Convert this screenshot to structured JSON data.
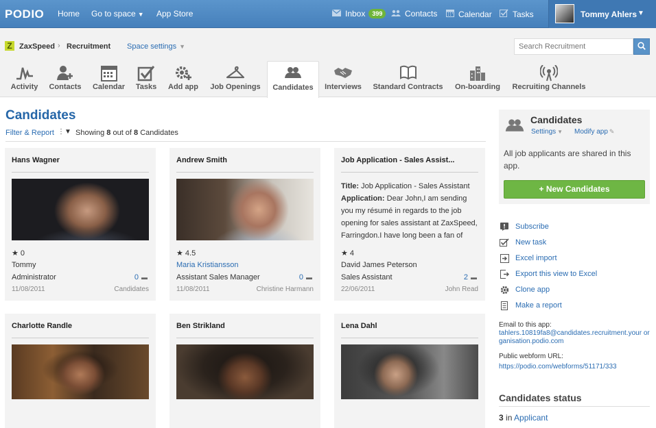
{
  "topbar": {
    "logo": "PODIO",
    "nav": {
      "home": "Home",
      "go_to_space": "Go to space",
      "app_store": "App Store"
    },
    "inbox_label": "Inbox",
    "inbox_count": "399",
    "contacts": "Contacts",
    "calendar": "Calendar",
    "tasks": "Tasks",
    "user_name": "Tommy Ahlers"
  },
  "spacebar": {
    "space_name": "ZaxSpeed",
    "separator": "›",
    "app_name": "Recruitment",
    "space_settings": "Space settings",
    "search_placeholder": "Search Recruitment"
  },
  "tabs": [
    {
      "label": "Activity",
      "icon": "activity-icon"
    },
    {
      "label": "Contacts",
      "icon": "add-contact-icon"
    },
    {
      "label": "Calendar",
      "icon": "calendar-icon"
    },
    {
      "label": "Tasks",
      "icon": "tasks-icon"
    },
    {
      "label": "Add app",
      "icon": "add-app-icon"
    },
    {
      "label": "Job Openings",
      "icon": "hanger-icon"
    },
    {
      "label": "Candidates",
      "icon": "people-icon",
      "active": true
    },
    {
      "label": "Interviews",
      "icon": "handshake-icon"
    },
    {
      "label": "Standard Contracts",
      "icon": "book-icon"
    },
    {
      "label": "On-boarding",
      "icon": "buildings-icon"
    },
    {
      "label": "Recruiting Channels",
      "icon": "broadcast-icon"
    }
  ],
  "main": {
    "title": "Candidates",
    "filter_link": "Filter & Report",
    "showing_prefix": "Showing",
    "showing_count": "8",
    "showing_mid": "out of",
    "showing_total": "8",
    "showing_suffix": "Candidates"
  },
  "cards": [
    {
      "title": "Hans Wagner",
      "rating": "★ 0",
      "line1": "Tommy",
      "line2": "Administrator",
      "comments": "0",
      "date": "11/08/2011",
      "owner": "Candidates"
    },
    {
      "title": "Andrew Smith",
      "rating": "★ 4.5",
      "line1": "Maria Kristiansson",
      "line2": "Assistant Sales Manager",
      "comments": "0",
      "date": "11/08/2011",
      "owner": "Christine Harmann"
    },
    {
      "title": "Job Application - Sales Assist...",
      "text_title_label": "Title:",
      "text_title": "Job Application - Sales Assistant",
      "text_app_label": "Application:",
      "text_app": "Dear John,I am sending you my résumé in regards to the job opening for sales assistant at ZaxSpeed, Farringdon.I have long been a fan of",
      "rating": "★ 4",
      "line1": "David James Peterson",
      "line2": "Sales Assistant",
      "comments": "2",
      "date": "22/06/2011",
      "owner": "John Read"
    },
    {
      "title": "Charlotte Randle"
    },
    {
      "title": "Ben Strikland"
    },
    {
      "title": "Lena Dahl"
    }
  ],
  "sidebar": {
    "title": "Candidates",
    "settings": "Settings",
    "modify_app": "Modify app",
    "description": "All job applicants are shared in this app.",
    "new_button": "New Candidates",
    "actions": [
      {
        "label": "Subscribe",
        "icon": "subscribe-icon"
      },
      {
        "label": "New task",
        "icon": "checkbox-icon"
      },
      {
        "label": "Excel import",
        "icon": "import-icon"
      },
      {
        "label": "Export this view to Excel",
        "icon": "export-icon"
      },
      {
        "label": "Clone app",
        "icon": "gear-icon"
      },
      {
        "label": "Make a report",
        "icon": "report-icon"
      }
    ],
    "email_label": "Email to this app:",
    "email_value": "tahlers.10819fa8@candidates.recruitment.your organisation.podio.com",
    "webform_label": "Public webform URL:",
    "webform_value": "https://podio.com/webforms/51171/333",
    "status_title": "Candidates status",
    "status_count": "3",
    "status_in": "in",
    "status_link": "Applicant"
  },
  "colors": {
    "topbar": "#4f8ac3",
    "link": "#2a6cb2",
    "title": "#2566a8",
    "button_green": "#6eb644",
    "badge_green": "#6fb53a"
  }
}
